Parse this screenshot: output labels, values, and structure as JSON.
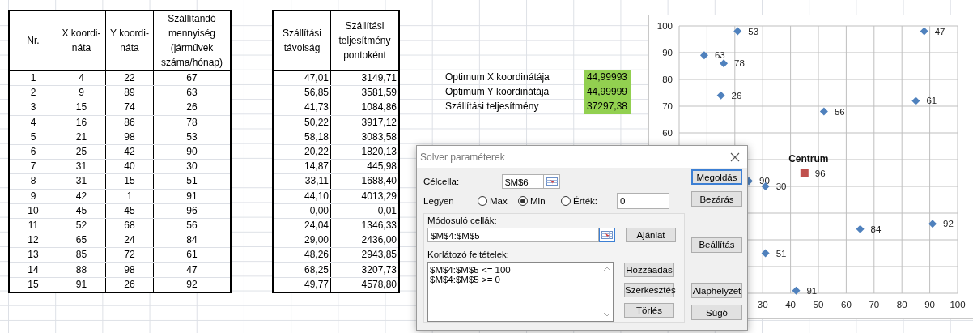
{
  "table": {
    "columns": [
      "Nr.",
      "X koordi-náta",
      "Y koordi-náta",
      "Szállítandó mennyiség (járművek száma/hónap)"
    ],
    "rows": [
      [
        "1",
        "4",
        "22",
        "67"
      ],
      [
        "2",
        "9",
        "89",
        "63"
      ],
      [
        "3",
        "15",
        "74",
        "26"
      ],
      [
        "4",
        "16",
        "86",
        "78"
      ],
      [
        "5",
        "21",
        "98",
        "53"
      ],
      [
        "6",
        "25",
        "42",
        "90"
      ],
      [
        "7",
        "31",
        "40",
        "30"
      ],
      [
        "8",
        "31",
        "15",
        "51"
      ],
      [
        "9",
        "42",
        "1",
        "91"
      ],
      [
        "10",
        "45",
        "45",
        "96"
      ],
      [
        "11",
        "52",
        "68",
        "56"
      ],
      [
        "12",
        "65",
        "24",
        "84"
      ],
      [
        "13",
        "85",
        "72",
        "61"
      ],
      [
        "14",
        "88",
        "98",
        "47"
      ],
      [
        "15",
        "91",
        "26",
        "92"
      ]
    ]
  },
  "results_table": {
    "columns": [
      "Szállítási távolság",
      "Szállítási teljesítmény pontoként"
    ],
    "rows": [
      [
        "47,01",
        "3149,71"
      ],
      [
        "56,85",
        "3581,59"
      ],
      [
        "41,73",
        "1084,86"
      ],
      [
        "50,22",
        "3917,12"
      ],
      [
        "58,18",
        "3083,58"
      ],
      [
        "20,22",
        "1820,13"
      ],
      [
        "14,87",
        "445,98"
      ],
      [
        "33,11",
        "1688,40"
      ],
      [
        "44,10",
        "4013,29"
      ],
      [
        "0,00",
        "0,01"
      ],
      [
        "24,04",
        "1346,33"
      ],
      [
        "29,00",
        "2436,00"
      ],
      [
        "48,26",
        "2943,85"
      ],
      [
        "68,25",
        "3207,73"
      ],
      [
        "49,77",
        "4578,80"
      ]
    ]
  },
  "optimum": [
    {
      "label": "Optimum X koordinátája",
      "value": "44,99993"
    },
    {
      "label": "Optimum Y koordinátája",
      "value": "44,99999"
    },
    {
      "label": "Szállítási teljesítmény",
      "value": "37297,38"
    }
  ],
  "chart": {
    "chart_data": {
      "type": "scatter",
      "x": [
        21,
        9,
        16,
        15,
        52,
        85,
        88,
        25,
        31,
        45,
        65,
        91,
        31,
        42
      ],
      "series": [
        {
          "color": "#4f81bd",
          "values": [
            98,
            89,
            86,
            74,
            68,
            72,
            98,
            42,
            40,
            null,
            24,
            26,
            15,
            1
          ]
        },
        {
          "name": "Centrum",
          "color": "#c0504d",
          "values": [
            null,
            null,
            null,
            null,
            null,
            null,
            null,
            null,
            null,
            45,
            null,
            null,
            null,
            null
          ]
        }
      ],
      "value_labels": [
        "53",
        "63",
        "78",
        "26",
        "56",
        "61",
        "47",
        "90",
        "30",
        "96",
        "84",
        "92",
        "51",
        "91"
      ],
      "grid": true,
      "xlim": [
        0,
        100
      ],
      "ylim": [
        0,
        100
      ],
      "xticks": [
        30,
        40,
        50,
        60,
        70,
        80,
        90,
        100
      ],
      "yticks": [
        60,
        70,
        80,
        90,
        100
      ]
    }
  },
  "dialog": {
    "title": "Solver paraméterek",
    "target_label": "Célcella:",
    "target_value": "$M$6",
    "goal_label": "Legyen",
    "goal_options": [
      {
        "label": "Max",
        "selected": false
      },
      {
        "label": "Min",
        "selected": true
      },
      {
        "label": "Érték:",
        "selected": false
      }
    ],
    "goal_value": "0",
    "changing_label": "Módosuló cellák:",
    "changing_value": "$M$4:$M$5",
    "guess_button": "Ajánlat",
    "constraints_label": "Korlátozó feltételek:",
    "constraints": [
      "$M$4:$M$5 <= 100",
      "$M$4:$M$5 >= 0"
    ],
    "constraint_buttons": [
      "Hozzáadás",
      "Szerkesztés",
      "Törlés"
    ],
    "button_groups": [
      {
        "buttons": [
          {
            "label": "Megoldás",
            "default": true
          },
          {
            "label": "Bezárás",
            "default": false
          }
        ]
      },
      {
        "buttons": [
          {
            "label": "Beállítás",
            "default": false
          }
        ]
      },
      {
        "buttons": [
          {
            "label": "Alaphelyzet",
            "default": false
          },
          {
            "label": "Súgó",
            "default": false
          }
        ]
      }
    ]
  }
}
